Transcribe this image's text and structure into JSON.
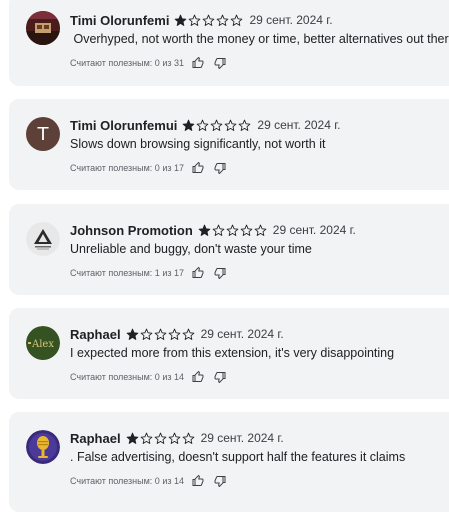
{
  "reviews": [
    {
      "author": "Timi Olorunfemi",
      "rating": 1,
      "date": "29 сент. 2024 г.",
      "text": " Overhyped, not worth the money or time, better alternatives out there",
      "helpful": "Считают полезным: 0 из 31",
      "avatar": {
        "type": "image",
        "icon": "dark-landscape-avatar-icon"
      }
    },
    {
      "author": "Timi Olorunfemui",
      "rating": 1,
      "date": "29 сент. 2024 г.",
      "text": "Slows down browsing significantly, not worth it",
      "helpful": "Считают полезным: 0 из 17",
      "avatar": {
        "type": "letter",
        "letter": "T",
        "color": "#5d4037"
      }
    },
    {
      "author": "Johnson Promotion",
      "rating": 1,
      "date": "29 сент. 2024 г.",
      "text": "Unreliable and buggy, don't waste your time",
      "helpful": "Считают полезным: 1 из 17",
      "avatar": {
        "type": "image",
        "icon": "triangle-logo-avatar-icon"
      }
    },
    {
      "author": "Raphael",
      "rating": 1,
      "date": "29 сент. 2024 г.",
      "text": "I expected more from this extension, it's very disappointing",
      "helpful": "Считают полезным: 0 из 14",
      "avatar": {
        "type": "image",
        "icon": "alex-logo-avatar-icon"
      }
    },
    {
      "author": "Raphael",
      "rating": 1,
      "date": "29 сент. 2024 г.",
      "text": ". False advertising, doesn't support half the features it claims",
      "helpful": "Считают полезным: 0 из 14",
      "avatar": {
        "type": "image",
        "icon": "microphone-avatar-icon"
      }
    }
  ],
  "max_rating": 5,
  "colors": {
    "card_bg": "#f1f3f4",
    "star": "#202124"
  }
}
